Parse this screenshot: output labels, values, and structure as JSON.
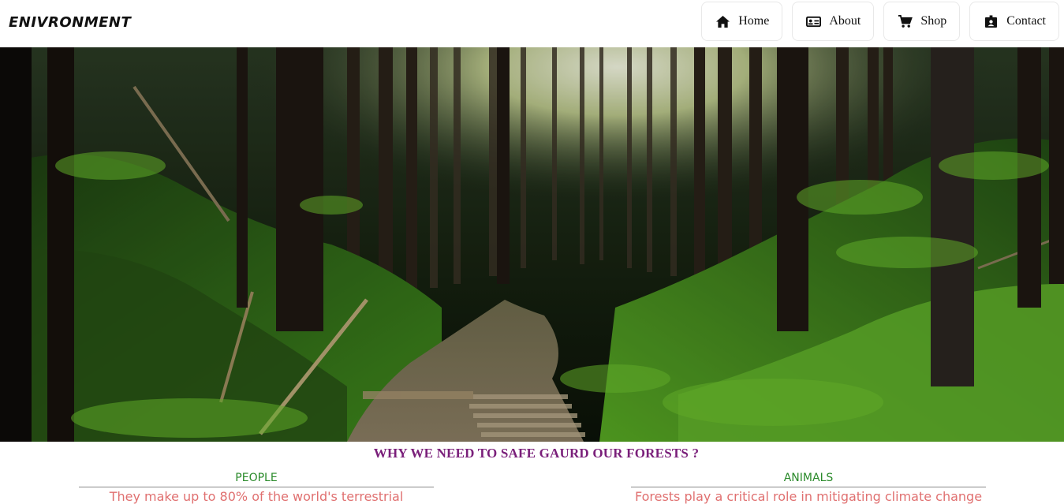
{
  "brand": "ENIVRONMENT",
  "nav": {
    "home": {
      "label": "Home",
      "icon": "home-icon"
    },
    "about": {
      "label": "About",
      "icon": "id-card-icon"
    },
    "shop": {
      "label": "Shop",
      "icon": "shopping-cart-icon"
    },
    "contact": {
      "label": "Contact",
      "icon": "contact-badge-icon"
    }
  },
  "hero": {
    "description": "forest path photo"
  },
  "section": {
    "heading": "WHY WE NEED TO SAFE GAURD OUR FORESTS ?",
    "people": {
      "title": "PEOPLE",
      "text": "They make up to 80% of the world's terrestrial"
    },
    "animals": {
      "title": "ANIMALS",
      "text": "Forests play a critical role in mitigating climate change"
    }
  },
  "colors": {
    "heading": "#7a1f7a",
    "column_title": "#2a8a2a",
    "column_text": "#e07070"
  }
}
